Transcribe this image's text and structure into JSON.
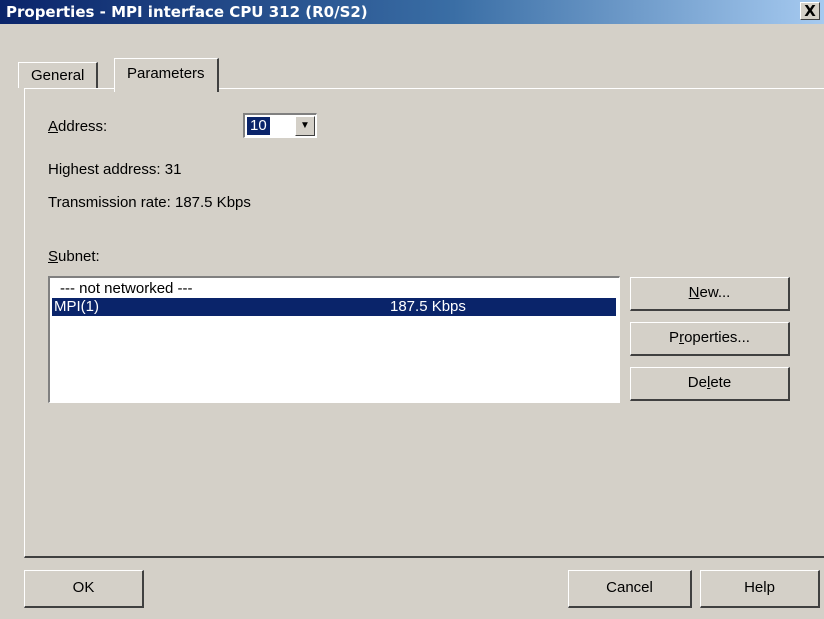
{
  "window": {
    "title": "Properties - MPI interface  CPU 312 (R0/S2)",
    "close_glyph": "X",
    "close_icon": "close-icon"
  },
  "tabs": [
    {
      "label": "General",
      "active": false
    },
    {
      "label": "Parameters",
      "active": true
    }
  ],
  "address": {
    "label_accel": "A",
    "label_rest": "ddress:",
    "value": "10",
    "dropdown_icon": "chevron-down-icon"
  },
  "highest_address": "Highest address:  31",
  "transmission_rate": "Transmission rate: 187.5 Kbps",
  "subnet": {
    "label_accel": "S",
    "label_rest": "ubnet:",
    "rows": [
      {
        "name": "--- not networked ---",
        "rate": "",
        "selected": false
      },
      {
        "name": "MPI(1)",
        "rate": "187.5 Kbps",
        "selected": true
      }
    ]
  },
  "side_buttons": {
    "new_accel": "N",
    "new_rest": "ew...",
    "properties_pre": "P",
    "properties_accel": "r",
    "properties_rest": "operties...",
    "delete_pre": "De",
    "delete_accel": "l",
    "delete_rest": "ete"
  },
  "footer": {
    "ok": "OK",
    "cancel": "Cancel",
    "help": "Help"
  },
  "colors": {
    "dialog_bg": "#d4d0c8",
    "title_start": "#0a246a",
    "title_end": "#a6caf0",
    "selection": "#0a246a"
  }
}
